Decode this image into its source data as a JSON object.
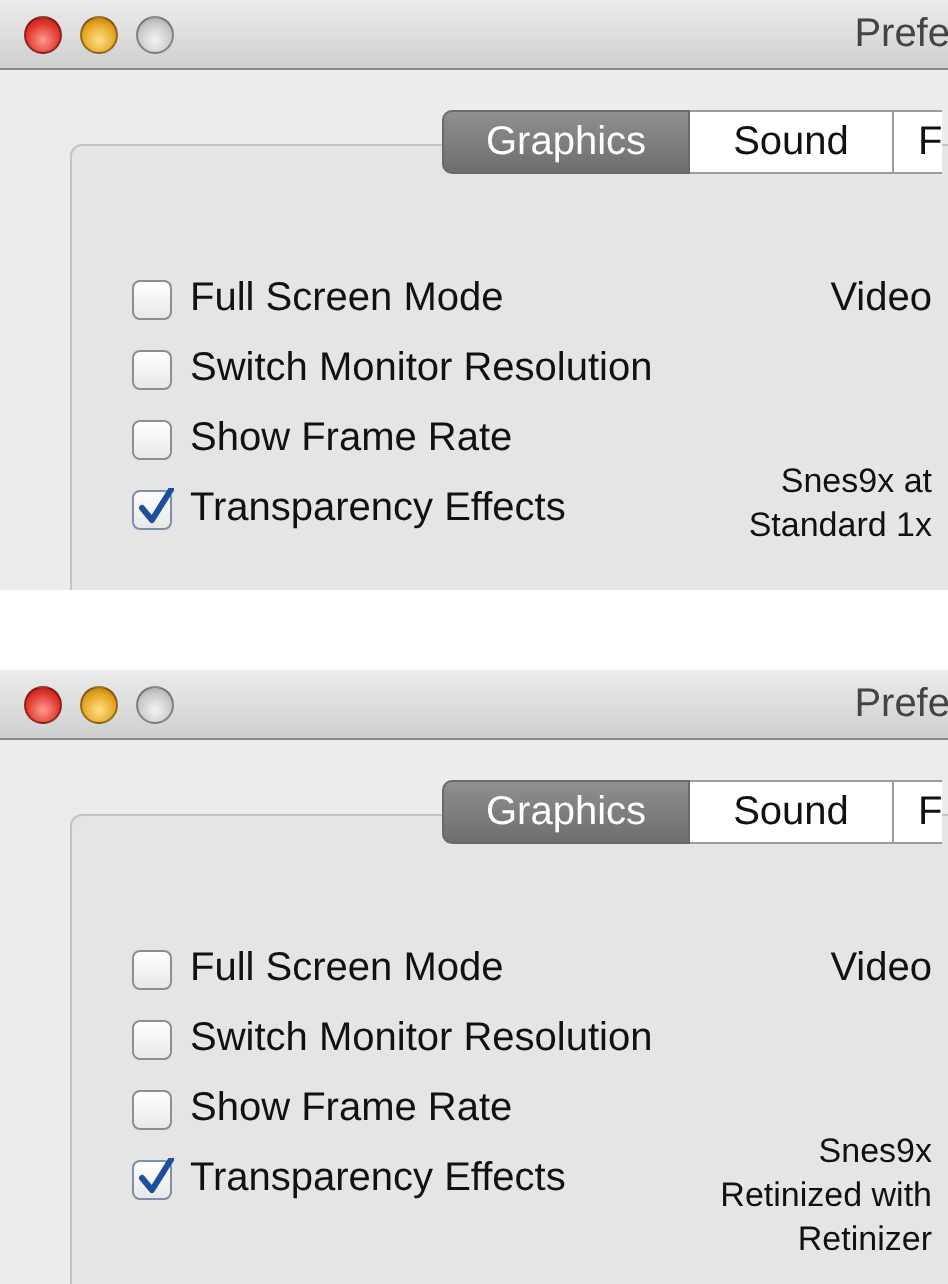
{
  "panels": [
    {
      "window": {
        "title": "Prefe"
      },
      "tabs": [
        {
          "label": "Graphics",
          "selected": true
        },
        {
          "label": "Sound",
          "selected": false
        },
        {
          "label": "F",
          "selected": false
        }
      ],
      "checkboxes": [
        {
          "label": "Full Screen Mode",
          "checked": false
        },
        {
          "label": "Switch Monitor Resolution",
          "checked": false
        },
        {
          "label": "Show Frame Rate",
          "checked": false
        },
        {
          "label": "Transparency Effects",
          "checked": true
        }
      ],
      "column_label": "Video",
      "caption_lines": [
        "Snes9x at",
        "Standard 1x"
      ]
    },
    {
      "window": {
        "title": "Prefe"
      },
      "tabs": [
        {
          "label": "Graphics",
          "selected": true
        },
        {
          "label": "Sound",
          "selected": false
        },
        {
          "label": "F",
          "selected": false
        }
      ],
      "checkboxes": [
        {
          "label": "Full Screen Mode",
          "checked": false
        },
        {
          "label": "Switch Monitor Resolution",
          "checked": false
        },
        {
          "label": "Show Frame Rate",
          "checked": false
        },
        {
          "label": "Transparency Effects",
          "checked": true
        }
      ],
      "column_label": "Video",
      "caption_lines": [
        "Snes9x",
        "Retinized with",
        "Retinizer"
      ]
    }
  ]
}
